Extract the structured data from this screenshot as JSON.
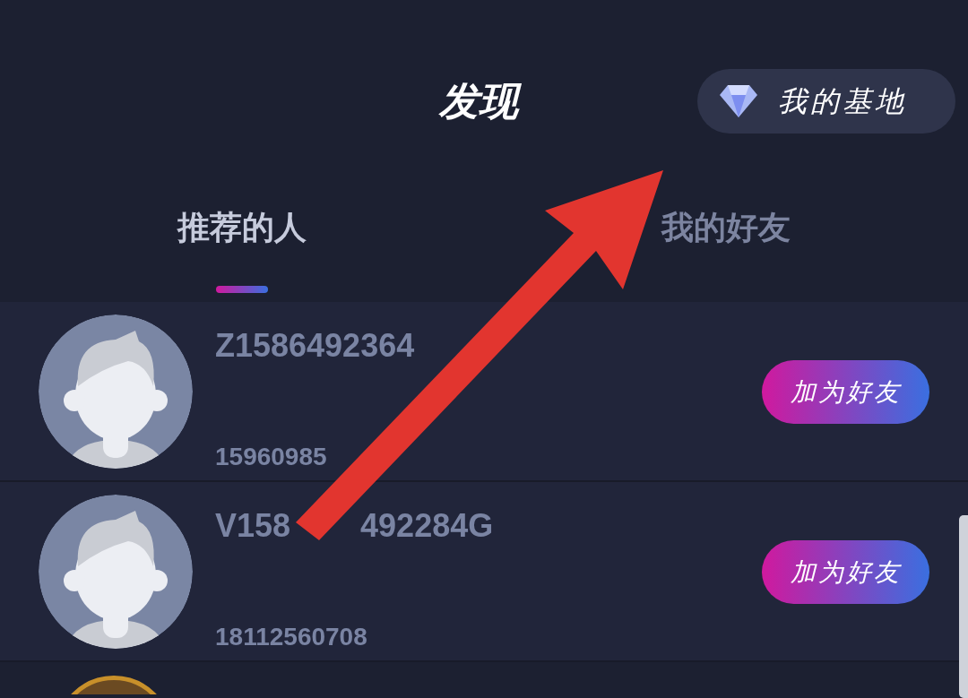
{
  "header": {
    "title": "发现",
    "base_button": "我的基地"
  },
  "tabs": [
    {
      "label": "推荐的人",
      "selected": true
    },
    {
      "label": "我的好友",
      "selected": false
    }
  ],
  "people": [
    {
      "name_parts": [
        "Z1586492364"
      ],
      "phone": "15960985",
      "button": "加为好友"
    },
    {
      "name_parts": [
        "V158",
        "492284G"
      ],
      "phone": "18112560708",
      "button": "加为好友"
    },
    {
      "kind": "cut"
    }
  ]
}
